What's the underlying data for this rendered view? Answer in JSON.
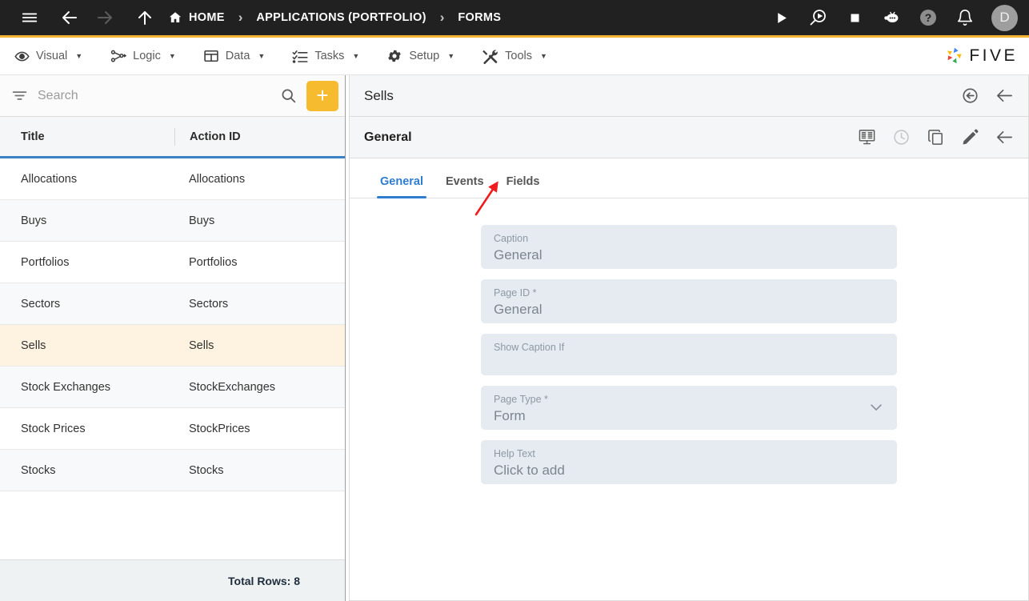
{
  "topbar": {
    "menu_icon": "hamburger-icon",
    "back_icon": "arrow-left-icon",
    "forward_icon": "arrow-right-icon",
    "up_icon": "arrow-up-icon",
    "breadcrumbs": [
      {
        "label": "HOME",
        "icon": "home-icon"
      },
      {
        "label": "APPLICATIONS (PORTFOLIO)",
        "icon": ""
      },
      {
        "label": "FORMS",
        "icon": ""
      }
    ],
    "separator": "›",
    "actions": [
      {
        "name": "run-icon",
        "glyph": "play"
      },
      {
        "name": "debug-run-icon",
        "glyph": "magnify-play"
      },
      {
        "name": "stop-icon",
        "glyph": "stop"
      },
      {
        "name": "chatbot-icon",
        "glyph": "robot"
      },
      {
        "name": "help-icon",
        "glyph": "question"
      },
      {
        "name": "notifications-icon",
        "glyph": "bell"
      }
    ],
    "avatar_initial": "D"
  },
  "menubar": {
    "items": [
      {
        "label": "Visual",
        "icon": "eye-icon"
      },
      {
        "label": "Logic",
        "icon": "flow-icon"
      },
      {
        "label": "Data",
        "icon": "table-icon"
      },
      {
        "label": "Tasks",
        "icon": "checklist-icon"
      },
      {
        "label": "Setup",
        "icon": "gear-icon"
      },
      {
        "label": "Tools",
        "icon": "tools-icon"
      }
    ],
    "caret": "▼",
    "brand": "FIVE"
  },
  "sidebar": {
    "search": {
      "placeholder": "Search",
      "value": ""
    },
    "filter_icon": "filter-icon",
    "search_icon": "search-icon",
    "add_label": "+",
    "columns": [
      "Title",
      "Action ID"
    ],
    "rows": [
      {
        "title": "Allocations",
        "action_id": "Allocations"
      },
      {
        "title": "Buys",
        "action_id": "Buys"
      },
      {
        "title": "Portfolios",
        "action_id": "Portfolios"
      },
      {
        "title": "Sectors",
        "action_id": "Sectors"
      },
      {
        "title": "Sells",
        "action_id": "Sells"
      },
      {
        "title": "Stock Exchanges",
        "action_id": "StockExchanges"
      },
      {
        "title": "Stock Prices",
        "action_id": "StockPrices"
      },
      {
        "title": "Stocks",
        "action_id": "Stocks"
      }
    ],
    "selected_index": 4,
    "footer": "Total Rows: 8"
  },
  "detail": {
    "record_title": "Sells",
    "record_actions": [
      {
        "name": "history-back-icon"
      },
      {
        "name": "close-panel-icon"
      }
    ],
    "section_title": "General",
    "section_actions": [
      {
        "name": "form-preview-icon"
      },
      {
        "name": "clock-icon"
      },
      {
        "name": "copy-icon"
      },
      {
        "name": "edit-icon"
      },
      {
        "name": "back-icon"
      }
    ],
    "tabs": [
      {
        "label": "General",
        "active": true
      },
      {
        "label": "Events",
        "active": false
      },
      {
        "label": "Fields",
        "active": false
      }
    ],
    "fields": [
      {
        "label": "Caption",
        "value": "General",
        "type": "text",
        "required": false
      },
      {
        "label": "Page ID *",
        "value": "General",
        "type": "text",
        "required": true
      },
      {
        "label": "Show Caption If",
        "value": "",
        "type": "text",
        "required": false
      },
      {
        "label": "Page Type *",
        "value": "Form",
        "type": "select",
        "required": true
      },
      {
        "label": "Help Text",
        "value": "Click to add",
        "type": "text",
        "required": false
      }
    ]
  },
  "annotation": {
    "type": "arrow",
    "color": "#ee1c1c",
    "points_to": "Fields"
  },
  "colors": {
    "topbar_bg": "#212121",
    "accent_yellow": "#f5b335",
    "tab_blue": "#2f7dd1",
    "selected_row": "#fdf3e0",
    "field_bg": "#e5ebf1",
    "annotation_red": "#ee1c1c"
  }
}
